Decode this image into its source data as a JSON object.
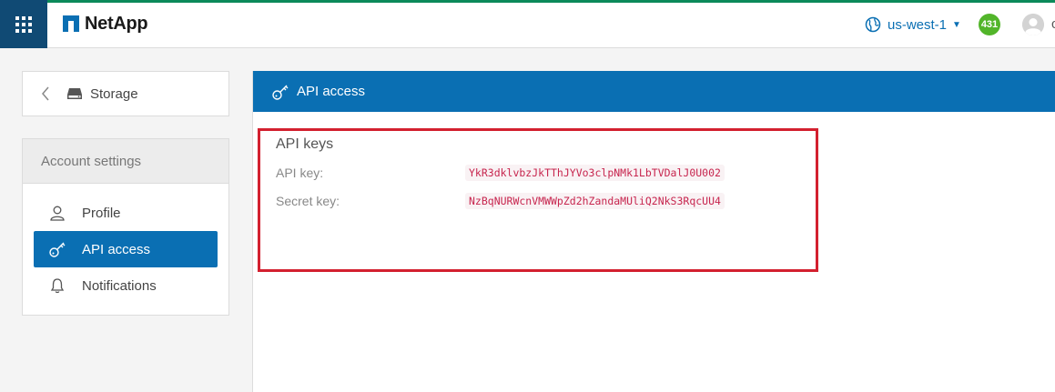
{
  "header": {
    "brand": "NetApp",
    "region": "us-west-1",
    "notification_count": "431",
    "user_initial": "c"
  },
  "sidebar": {
    "back_label": "Storage",
    "settings_title": "Account settings",
    "items": [
      {
        "label": "Profile",
        "icon": "user-icon",
        "active": false
      },
      {
        "label": "API access",
        "icon": "key-icon",
        "active": true
      },
      {
        "label": "Notifications",
        "icon": "bell-icon",
        "active": false
      }
    ]
  },
  "main": {
    "title": "API access",
    "section_title": "API keys",
    "api_key_label": "API key:",
    "api_key_value": "YkR3dklvbzJkTThJYVo3clpNMk1LbTVDalJ0U002",
    "secret_key_label": "Secret key:",
    "secret_key_value": "NzBqNURWcnVMWWpZd2hZandaMUliQ2NkS3RqcUU4"
  },
  "colors": {
    "accent_blue": "#0a6fb3",
    "apps_button": "#104a74",
    "badge_green": "#52b52a",
    "highlight_red": "#d3202f"
  }
}
